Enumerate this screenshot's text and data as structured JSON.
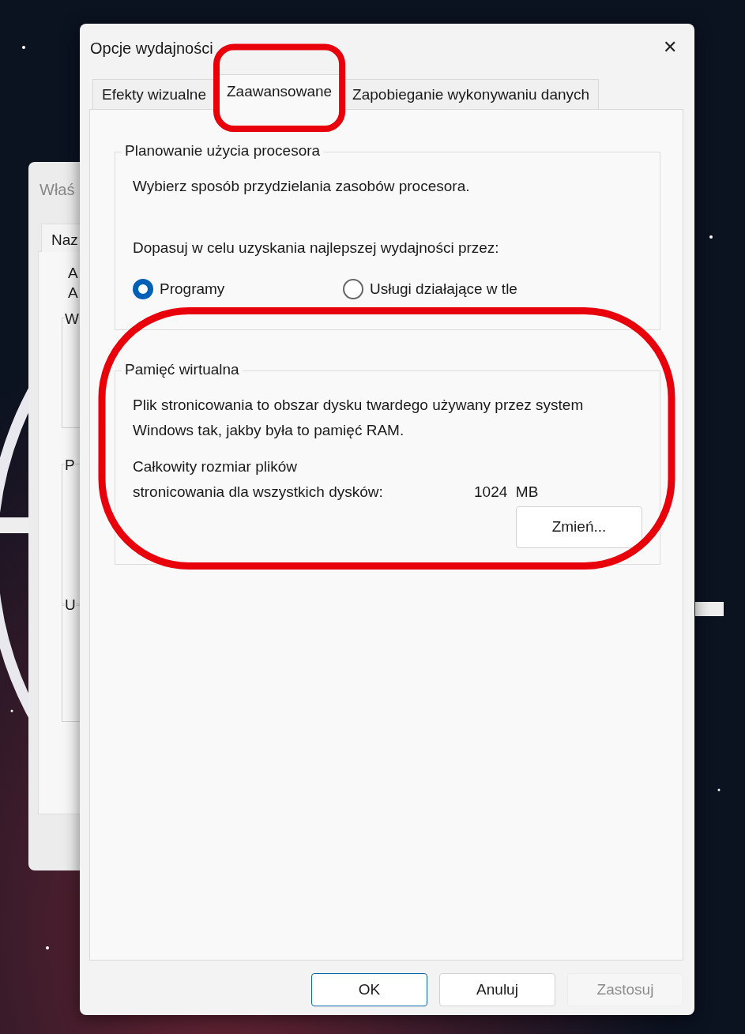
{
  "background_window": {
    "title": "Właś",
    "tab": "Naz",
    "texts": [
      "A",
      "A"
    ],
    "groups": [
      "W",
      "P",
      "U"
    ]
  },
  "window": {
    "title": "Opcje wydajności",
    "close": "✕"
  },
  "tabs": [
    {
      "label": "Efekty wizualne",
      "selected": false
    },
    {
      "label": "Zaawansowane",
      "selected": true
    },
    {
      "label": "Zapobieganie wykonywaniu danych",
      "selected": false
    }
  ],
  "processor_group": {
    "legend": "Planowanie użycia procesora",
    "description": "Wybierz sposób przydzielania zasobów procesora.",
    "adjust_label": "Dopasuj w celu uzyskania najlepszej wydajności przez:",
    "options": [
      {
        "label": "Programy",
        "selected": true
      },
      {
        "label": "Usługi działające w tle",
        "selected": false
      }
    ]
  },
  "memory_group": {
    "legend": "Pamięć wirtualna",
    "description": "Plik stronicowania to obszar dysku twardego używany przez system Windows tak, jakby była to pamięć RAM.",
    "size_label_1": "Całkowity rozmiar plików",
    "size_label_2": "stronicowania dla wszystkich dysków:",
    "size_value": "1024  MB",
    "button": "Zmień..."
  },
  "buttons": [
    {
      "label": "OK",
      "disabled": false,
      "default": true
    },
    {
      "label": "Anuluj",
      "disabled": false,
      "default": false
    },
    {
      "label": "Zastosuj",
      "disabled": true,
      "default": false
    }
  ]
}
